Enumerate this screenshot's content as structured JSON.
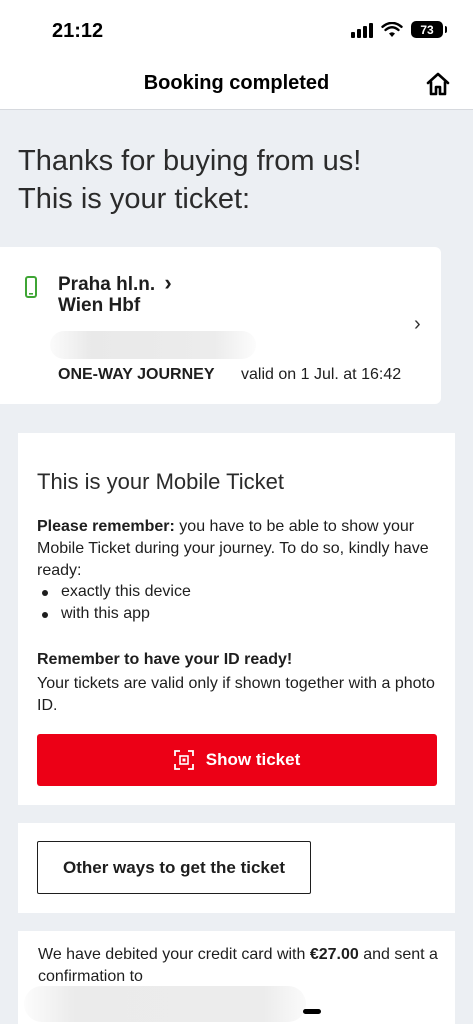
{
  "status_bar": {
    "time": "21:12",
    "battery": "73"
  },
  "nav": {
    "title": "Booking completed",
    "home_icon": "home-icon"
  },
  "headline": {
    "line1": "Thanks for buying from us!",
    "line2": "This is your ticket:"
  },
  "ticket": {
    "from": "Praha hl.n.",
    "from_arrow": "›",
    "to": "Wien Hbf",
    "journey_type": "ONE-WAY JOURNEY",
    "validity": "valid on 1 Jul. at 16:42",
    "chevron": "›",
    "device_icon": "phone-icon",
    "device_color": "#3fa535"
  },
  "mobile_ticket": {
    "title": "This is your Mobile Ticket",
    "remember_label": "Please remember:",
    "remember_text": " you have to be able to show your Mobile Ticket during your journey. To do so, kindly have ready:",
    "bullets": [
      "exactly this device",
      "with this app"
    ],
    "id_title": "Remember to have your ID ready!",
    "id_text": "Your tickets are valid only if shown together with a photo ID.",
    "show_button": "Show ticket",
    "show_button_icon": "qr-scan-icon",
    "accent_color": "#ec0016"
  },
  "other_ways": {
    "button": "Other ways to get the ticket"
  },
  "payment": {
    "text_before": "We have debited your credit card with ",
    "amount": "€27.00",
    "text_after": " and sent a confirmation to"
  }
}
